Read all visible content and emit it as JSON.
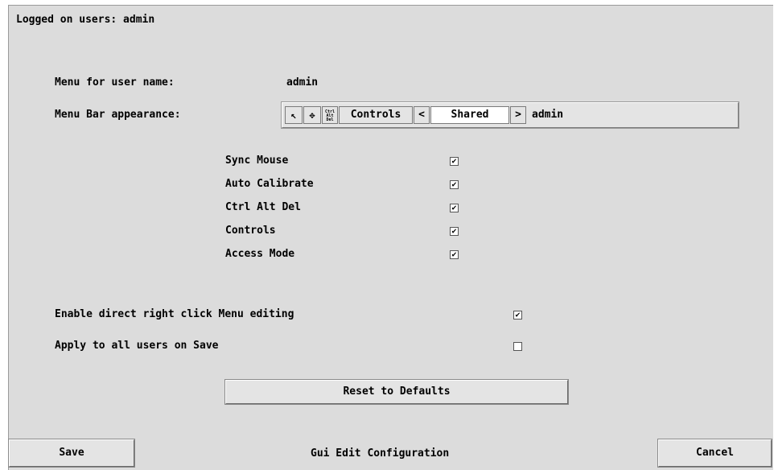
{
  "header": {
    "logged_on": "Logged on users: admin"
  },
  "menu_user": {
    "label": "Menu for user name:",
    "value": "admin"
  },
  "menubar": {
    "label": "Menu Bar appearance:",
    "icons": [
      "mouse-sync-icon",
      "move-icon",
      "ctrl-alt-del-icon"
    ],
    "ctrl_alt_del_text": "Ctrl Alt Del",
    "controls": "Controls",
    "prev": "<",
    "mode": "Shared",
    "next": ">",
    "user": "admin"
  },
  "options": [
    {
      "label": "Sync Mouse",
      "checked": true
    },
    {
      "label": "Auto Calibrate",
      "checked": true
    },
    {
      "label": "Ctrl Alt Del",
      "checked": true
    },
    {
      "label": "Controls",
      "checked": true
    },
    {
      "label": "Access Mode",
      "checked": true
    }
  ],
  "enable_edit": {
    "label": "Enable direct right click Menu editing",
    "checked": true
  },
  "apply_all": {
    "label": "Apply to all users on Save",
    "checked": false
  },
  "check_mark": "✔",
  "reset_label": "Reset to Defaults",
  "footer": {
    "save": "Save",
    "title": "Gui Edit Configuration",
    "cancel": "Cancel"
  }
}
